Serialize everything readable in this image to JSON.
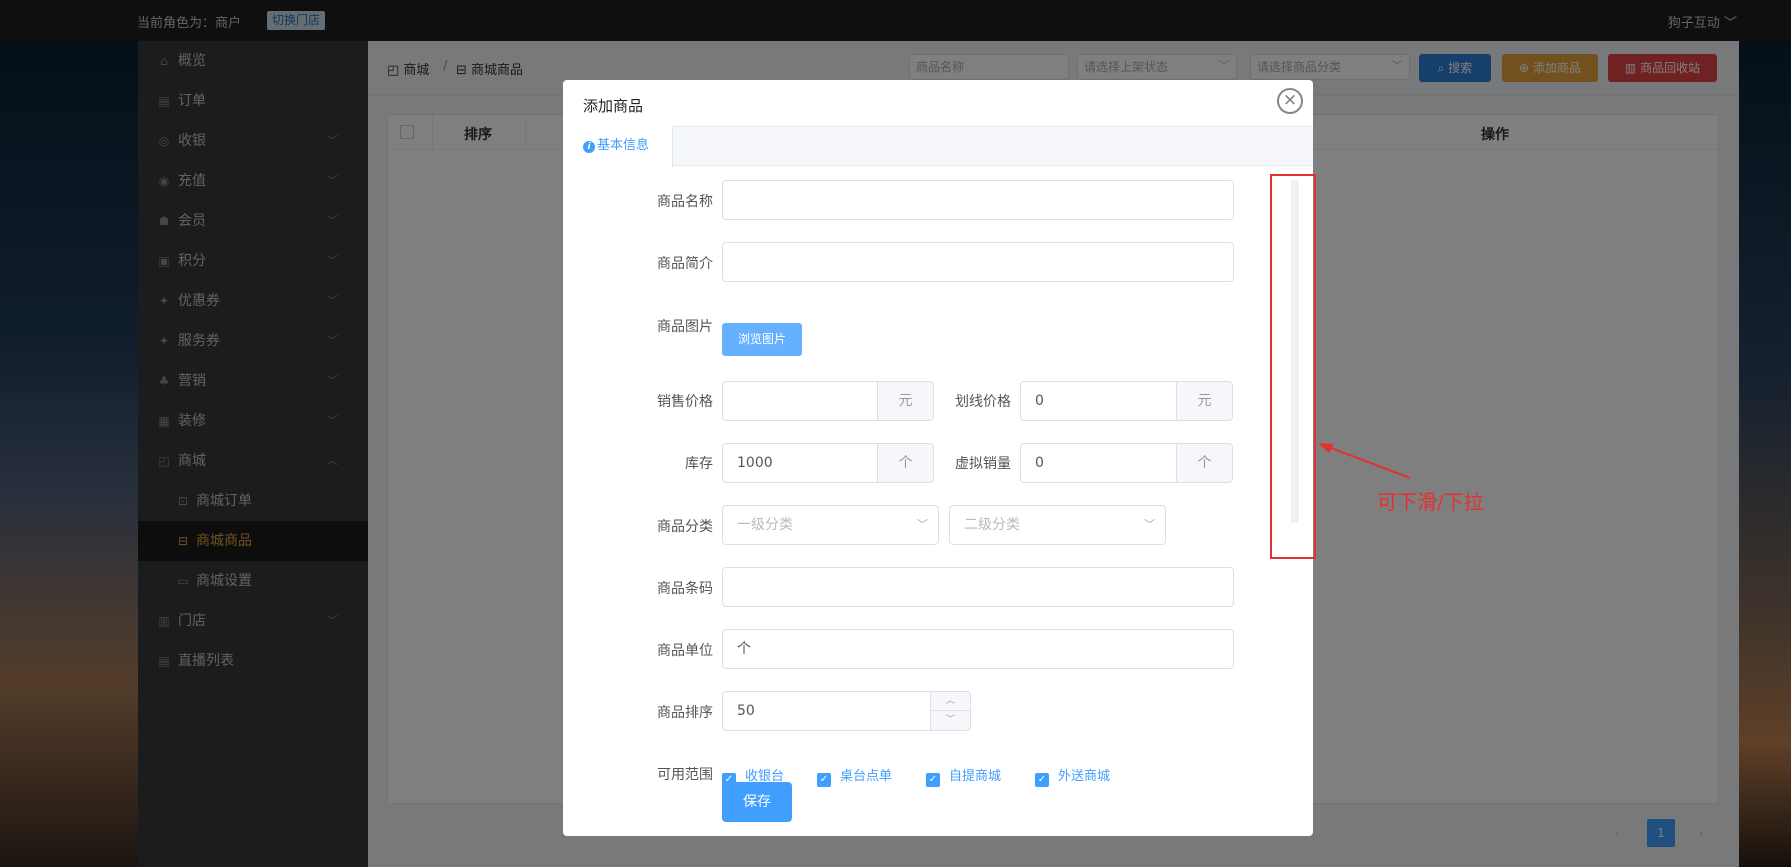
{
  "topbar": {
    "role_text": "当前角色为：商户",
    "switch_store": "切换门店",
    "user_name": "狗子互动 ﹀"
  },
  "sidebar": {
    "items": [
      {
        "label": "概览",
        "icon": "home-icon",
        "has_arrow": false
      },
      {
        "label": "订单",
        "icon": "order-icon",
        "has_arrow": false
      },
      {
        "label": "收银",
        "icon": "cashier-icon",
        "has_arrow": true
      },
      {
        "label": "充值",
        "icon": "recharge-icon",
        "has_arrow": true
      },
      {
        "label": "会员",
        "icon": "member-icon",
        "has_arrow": true
      },
      {
        "label": "积分",
        "icon": "points-icon",
        "has_arrow": true
      },
      {
        "label": "优惠券",
        "icon": "coupon-icon",
        "has_arrow": true
      },
      {
        "label": "服务券",
        "icon": "service-coupon-icon",
        "has_arrow": true
      },
      {
        "label": "营销",
        "icon": "marketing-icon",
        "has_arrow": true
      },
      {
        "label": "装修",
        "icon": "decoration-icon",
        "has_arrow": true
      },
      {
        "label": "商城",
        "icon": "mall-icon",
        "has_arrow": true,
        "expanded": true
      },
      {
        "label": "商城订单",
        "icon": "cart-icon",
        "sub": true
      },
      {
        "label": "商城商品",
        "icon": "bag-icon",
        "sub": true,
        "active": true
      },
      {
        "label": "商城设置",
        "icon": "settings-icon",
        "sub": true
      },
      {
        "label": "门店",
        "icon": "store-icon",
        "has_arrow": true
      },
      {
        "label": "直播列表",
        "icon": "live-list-icon",
        "has_arrow": false
      }
    ]
  },
  "breadcrumb": {
    "root": "商城",
    "current": "商城商品"
  },
  "toolbar": {
    "name_placeholder": "商品名称",
    "status_placeholder": "请选择上架状态",
    "category_placeholder": "请选择商品分类",
    "search_label": "搜索",
    "add_label": "添加商品",
    "recycle_label": "商品回收站"
  },
  "table": {
    "headers": {
      "sort": "排序",
      "action": "操作"
    }
  },
  "pagination": {
    "current": "1"
  },
  "modal": {
    "title": "添加商品",
    "tab": "基本信息",
    "fields": {
      "name_label": "商品名称",
      "name_value": "",
      "intro_label": "商品简介",
      "intro_value": "",
      "image_label": "商品图片",
      "browse_label": "浏览图片",
      "price_label": "销售价格",
      "price_value": "",
      "price_suffix": "元",
      "line_price_label": "划线价格",
      "line_price_value": "0",
      "line_price_suffix": "元",
      "stock_label": "库存",
      "stock_value": "1000",
      "stock_suffix": "个",
      "virtual_sales_label": "虚拟销量",
      "virtual_sales_value": "0",
      "virtual_sales_suffix": "个",
      "category_label": "商品分类",
      "category1_placeholder": "一级分类",
      "category2_placeholder": "二级分类",
      "barcode_label": "商品条码",
      "barcode_value": "",
      "unit_label": "商品单位",
      "unit_value": "个",
      "sort_label": "商品排序",
      "sort_value": "50",
      "scope_label": "可用范围",
      "scope_options": [
        "收银台",
        "桌台点单",
        "自提商城",
        "外送商城"
      ]
    },
    "save_label": "保存"
  },
  "annotation": {
    "text": "可下滑/下拉",
    "color": "#e53030"
  },
  "colors": {
    "primary": "#409eff",
    "search_btn": "#2f7fd6",
    "add_btn": "#e6a23c",
    "recycle_btn": "#e04343",
    "sidebar_active": "#e6a23c"
  }
}
